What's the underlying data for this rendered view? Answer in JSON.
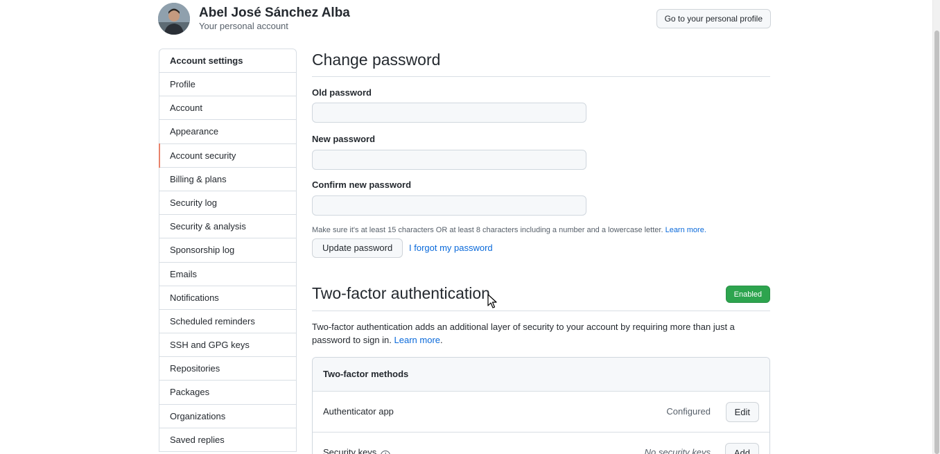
{
  "header": {
    "user_name": "Abel José Sánchez Alba",
    "user_subtitle": "Your personal account",
    "profile_button": "Go to your personal profile"
  },
  "sidebar": {
    "heading": "Account settings",
    "items": [
      {
        "label": "Profile"
      },
      {
        "label": "Account"
      },
      {
        "label": "Appearance"
      },
      {
        "label": "Account security",
        "active": true
      },
      {
        "label": "Billing & plans"
      },
      {
        "label": "Security log"
      },
      {
        "label": "Security & analysis"
      },
      {
        "label": "Sponsorship log"
      },
      {
        "label": "Emails"
      },
      {
        "label": "Notifications"
      },
      {
        "label": "Scheduled reminders"
      },
      {
        "label": "SSH and GPG keys"
      },
      {
        "label": "Repositories"
      },
      {
        "label": "Packages"
      },
      {
        "label": "Organizations"
      },
      {
        "label": "Saved replies"
      }
    ],
    "active_accent": "#e8836b"
  },
  "change_password": {
    "title": "Change password",
    "old_label": "Old password",
    "old_value": "",
    "new_label": "New password",
    "new_value": "",
    "confirm_label": "Confirm new password",
    "confirm_value": "",
    "hint": "Make sure it's at least 15 characters OR at least 8 characters including a number and a lowercase letter.",
    "hint_link": "Learn more.",
    "update_button": "Update password",
    "forgot_link": "I forgot my password"
  },
  "two_factor": {
    "title": "Two-factor authentication",
    "status_badge": "Enabled",
    "badge_color": "#2da44e",
    "description": "Two-factor authentication adds an additional layer of security to your account by requiring more than just a password to sign in.",
    "learn_more": "Learn more",
    "methods_heading": "Two-factor methods",
    "methods": [
      {
        "name": "Authenticator app",
        "status": "Configured",
        "button": "Edit"
      },
      {
        "name": "Security keys",
        "status": "No security keys",
        "button": "Add",
        "icon": "info-icon"
      }
    ]
  }
}
